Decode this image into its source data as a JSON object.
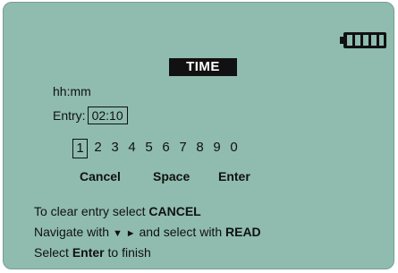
{
  "screen": {
    "title": "TIME",
    "format_label": "hh:mm",
    "entry_label": "Entry:",
    "entry_value": "02:10",
    "battery_level": 1.0
  },
  "keypad": {
    "digits": [
      "1",
      "2",
      "3",
      "4",
      "5",
      "6",
      "7",
      "8",
      "9",
      "0"
    ],
    "selected_digit": "1"
  },
  "actions": {
    "cancel": "Cancel",
    "space": "Space",
    "enter": "Enter"
  },
  "help": {
    "line1_pre": "To clear entry select ",
    "line1_bold": "CANCEL",
    "line2_pre": "Navigate with ",
    "line2_down": "▼",
    "line2_right": "►",
    "line2_mid": " and select with ",
    "line2_bold": "READ",
    "line3_pre": "Select ",
    "line3_bold": "Enter",
    "line3_post": " to finish"
  },
  "colors": {
    "screen_bg": "#8fbcae",
    "text": "#111111"
  }
}
